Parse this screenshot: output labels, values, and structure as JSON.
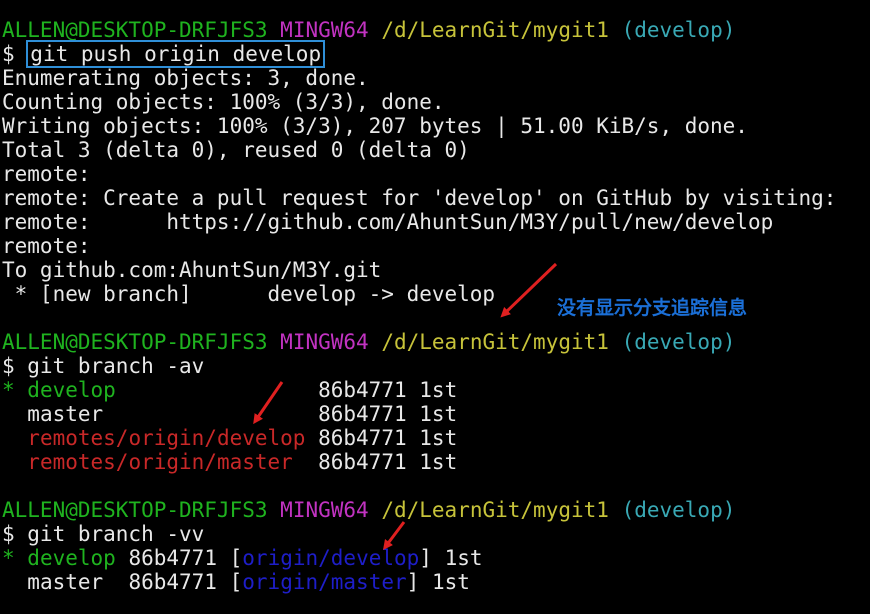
{
  "prompt": {
    "user": "ALLEN@DESKTOP-DRFJFS3",
    "system": "MINGW64",
    "path": "/d/LearnGit/mygit1",
    "branch": "(develop)"
  },
  "block1": {
    "ps": "$ ",
    "command": "git push origin develop",
    "output": [
      "Enumerating objects: 3, done.",
      "Counting objects: 100% (3/3), done.",
      "Writing objects: 100% (3/3), 207 bytes | 51.00 KiB/s, done.",
      "Total 3 (delta 0), reused 0 (delta 0)",
      "remote:",
      "remote: Create a pull request for 'develop' on GitHub by visiting:",
      "remote:      https://github.com/AhuntSun/M3Y/pull/new/develop",
      "remote:",
      "To github.com:AhuntSun/M3Y.git",
      " * [new branch]      develop -> develop"
    ]
  },
  "annotation": {
    "text": "没有显示分支追踪信息",
    "color": "#1b6fd6"
  },
  "block2": {
    "command": "$ git branch -av",
    "rows": [
      {
        "marker": "* ",
        "name": "develop",
        "pad": "                ",
        "hash": "86b4771",
        "msg": "1st"
      },
      {
        "marker": "  ",
        "name": "master",
        "pad": "                 ",
        "hash": "86b4771",
        "msg": "1st"
      },
      {
        "marker": "  ",
        "name": "remotes/origin/develop",
        "pad": " ",
        "hash": "86b4771",
        "msg": "1st"
      },
      {
        "marker": "  ",
        "name": "remotes/origin/master",
        "pad": "  ",
        "hash": "86b4771",
        "msg": "1st"
      }
    ]
  },
  "block3": {
    "command": "$ git branch -vv",
    "rows": [
      {
        "marker": "* ",
        "name": "develop",
        "pad": " ",
        "hash": "86b4771",
        "open": " [",
        "upstream": "origin/develop",
        "close": "]",
        "msg": " 1st"
      },
      {
        "marker": "  ",
        "name": "master",
        "pad": "  ",
        "hash": "86b4771",
        "open": " [",
        "upstream": "origin/master",
        "close": "]",
        "msg": " 1st"
      }
    ]
  },
  "colors": {
    "background": "#000000",
    "text": "#e8e8e8",
    "user": "#1fb31f",
    "system": "#c233c2",
    "path": "#c7c33a",
    "branch": "#39a9b5",
    "remote_branch": "#c82828",
    "upstream": "#1e1ec8",
    "highlight_box": "#2f8fd8",
    "arrow": "#e02020"
  }
}
